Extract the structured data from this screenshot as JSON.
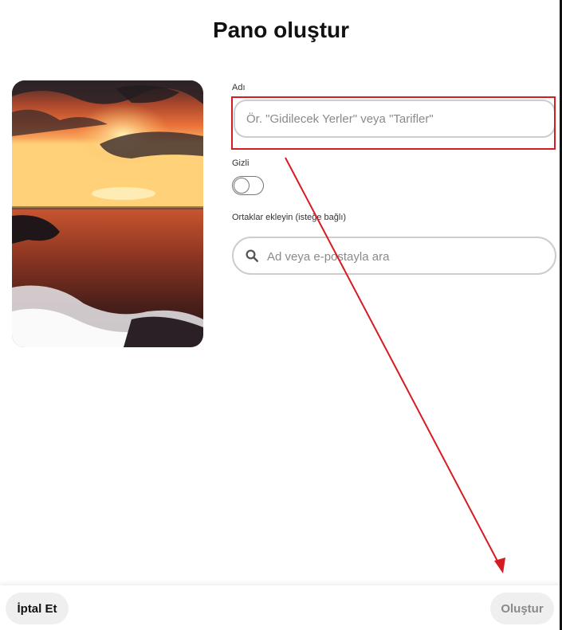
{
  "dialog": {
    "title": "Pano oluştur"
  },
  "form": {
    "name_label": "Adı",
    "name_placeholder": "Ör. \"Gidilecek Yerler\" veya \"Tarifler\"",
    "name_value": "",
    "secret_label": "Gizli",
    "secret_enabled": false,
    "collaborators_label": "Ortaklar ekleyin (isteğe bağlı)",
    "collaborators_placeholder": "Ad veya e-postayla ara"
  },
  "footer": {
    "cancel_label": "İptal Et",
    "create_label": "Oluştur"
  },
  "annotations": {
    "highlight_color": "#d61c23",
    "arrow_color": "#d61c23"
  },
  "icons": {
    "search": "search-icon"
  }
}
